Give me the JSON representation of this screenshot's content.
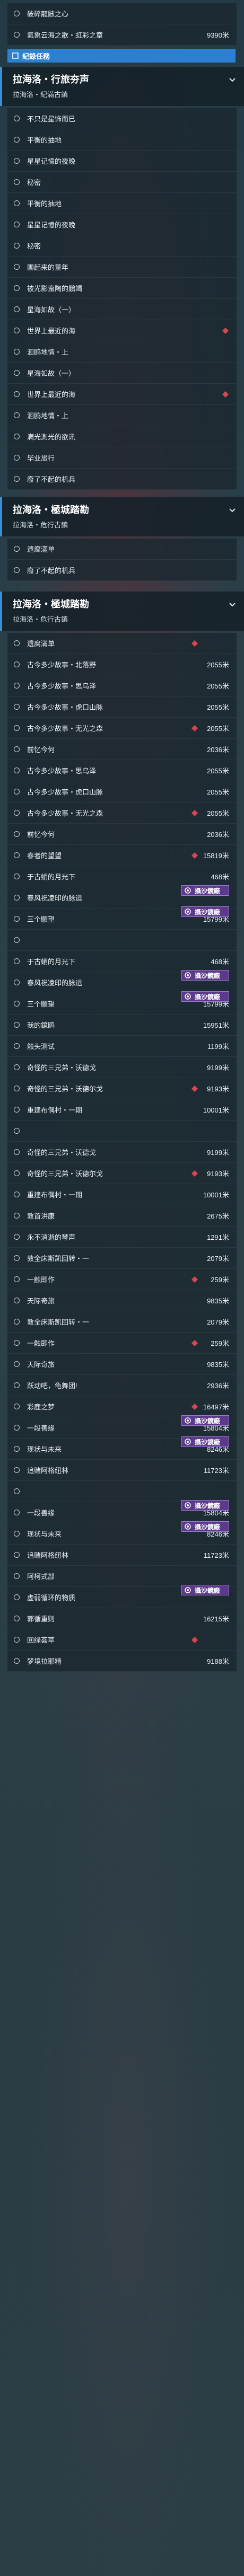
{
  "accent": "#2d7fd0",
  "badge_color": "#5c3a8a",
  "rows_top": [
    {
      "name": "破碎龍骸之心",
      "dist": ""
    },
    {
      "name": "氣象云海之歌・虹彩之章",
      "dist": "9390米"
    }
  ],
  "tag_label": "紀錄任務",
  "header1": {
    "title": "拉海洛・行旅夯声",
    "sub": "拉海洛・紀滿古鎮"
  },
  "section1": [
    {
      "name": "不只是星饰而已",
      "dist": ""
    },
    {
      "name": "平衡的抽地",
      "dist": ""
    },
    {
      "name": "星星记憶的夜晚",
      "dist": ""
    },
    {
      "name": "秘密",
      "dist": ""
    },
    {
      "name": "平衡的抽地",
      "dist": ""
    },
    {
      "name": "星星记憶的夜晚",
      "dist": ""
    },
    {
      "name": "秘密",
      "dist": ""
    },
    {
      "name": "團起来的童年",
      "dist": ""
    },
    {
      "name": "被光影蛮陶的鵬竭",
      "dist": ""
    },
    {
      "name": "星海如故（一）",
      "dist": ""
    },
    {
      "name": "世界上最近的海",
      "dist": ""
    },
    {
      "name": "洄鸥地情・上",
      "dist": ""
    },
    {
      "name": "星海如故（一）",
      "dist": ""
    },
    {
      "name": "世界上最近的海",
      "dist": ""
    },
    {
      "name": "洄鸥地情・上",
      "dist": ""
    },
    {
      "name": "满光測光的欲讯",
      "dist": ""
    },
    {
      "name": "毕业旅行",
      "dist": ""
    },
    {
      "name": "廢了不起的机兵",
      "dist": ""
    }
  ],
  "header2": {
    "title": "拉海洛・極城踏勘",
    "sub": "拉海洛・危行古鎮"
  },
  "section2": [
    {
      "name": "遗腐滿单",
      "dist": ""
    },
    {
      "name": "廢了不起的机兵",
      "dist": ""
    }
  ],
  "header3": {
    "title": "拉海洛・極城踏勘",
    "sub": "拉海洛・危行古鎮"
  },
  "section3": [
    {
      "name": "遗腐滿单",
      "dist": ""
    },
    {
      "name": "古今多少故事・北落野",
      "dist": "2055米"
    },
    {
      "name": "古今多少故事・思乌泽",
      "dist": "2055米"
    },
    {
      "name": "古今多少故事・虎口山脉",
      "dist": "2055米"
    },
    {
      "name": "古今多少故事・无光之森",
      "dist": "2055米"
    },
    {
      "name": "前忆今何",
      "dist": "2036米"
    },
    {
      "name": "古今多少故事・思乌泽",
      "dist": "2055米"
    },
    {
      "name": "古今多少故事・虎口山脉",
      "dist": "2055米"
    },
    {
      "name": "古今多少故事・无光之森",
      "dist": "2055米"
    },
    {
      "name": "前忆今何",
      "dist": "2036米"
    },
    {
      "name": "春者的望望",
      "dist": "15819米"
    },
    {
      "name": "于古蛸的月光下",
      "dist": "468米"
    },
    {
      "name": "春风祝凌印的脉运",
      "dist": "",
      "badge": "攝沙鏡廠"
    },
    {
      "name": "三个願望",
      "dist": "15799米",
      "badge": "攝沙鏡廠"
    },
    {
      "name": "",
      "dist": ""
    },
    {
      "name": "于古蛸的月光下",
      "dist": "468米"
    },
    {
      "name": "春风祝凌印的脉运",
      "dist": "",
      "badge": "攝沙鏡廠"
    },
    {
      "name": "三个願望",
      "dist": "15799米",
      "badge": "攝沙鏡廠"
    },
    {
      "name": "我的鏡鸥",
      "dist": "15951米"
    },
    {
      "name": "触头测试",
      "dist": "1199米"
    },
    {
      "name": "奇怪的三兄弟・沃德戈",
      "dist": "9199米"
    },
    {
      "name": "奇怪的三兄弟・沃德尔戈",
      "dist": "9193米"
    },
    {
      "name": "重建布偶村・一期",
      "dist": "10001米"
    },
    {
      "name": "",
      "dist": ""
    },
    {
      "name": "奇怪的三兄弟・沃德戈",
      "dist": "9199米"
    },
    {
      "name": "奇怪的三兄弟・沃德尔戈",
      "dist": "9193米"
    },
    {
      "name": "重建布偶村・一期",
      "dist": "10001米"
    },
    {
      "name": "敦首洪康",
      "dist": "2675米"
    },
    {
      "name": "永不消逝的琴声",
      "dist": "1291米"
    },
    {
      "name": "敦全床斯凯回转・一",
      "dist": "2079米"
    },
    {
      "name": "一触即作",
      "dist": "259米"
    },
    {
      "name": "天际奇旅",
      "dist": "9835米"
    },
    {
      "name": "敦全床斯凯回转・一",
      "dist": "2079米"
    },
    {
      "name": "一触即作",
      "dist": "259米"
    },
    {
      "name": "天际奇旅",
      "dist": "9835米"
    },
    {
      "name": "跃动吧，龟舞团!",
      "dist": "2936米"
    },
    {
      "name": "彩鹿之梦",
      "dist": "16497米"
    },
    {
      "name": "一段善缘",
      "dist": "15804米",
      "badge": "攝沙鏡廠"
    },
    {
      "name": "现状与未来",
      "dist": "8246米",
      "badge": "攝沙鏡廠"
    },
    {
      "name": "追赌阿格纽林",
      "dist": "11723米"
    },
    {
      "name": "",
      "dist": ""
    },
    {
      "name": "一段善缘",
      "dist": "15804米",
      "badge": "攝沙鏡廠"
    },
    {
      "name": "现状与未来",
      "dist": "8246米",
      "badge": "攝沙鏡廠"
    },
    {
      "name": "追赌阿格纽林",
      "dist": "11723米"
    },
    {
      "name": "阿柯式部",
      "dist": ""
    },
    {
      "name": "虚弱循环的物质",
      "dist": "",
      "badge": "攝沙鏡廠"
    },
    {
      "name": "郭循重则",
      "dist": "16215米"
    },
    {
      "name": "回绿荟萃",
      "dist": ""
    },
    {
      "name": "梦境拉耶精",
      "dist": "9188米"
    }
  ]
}
